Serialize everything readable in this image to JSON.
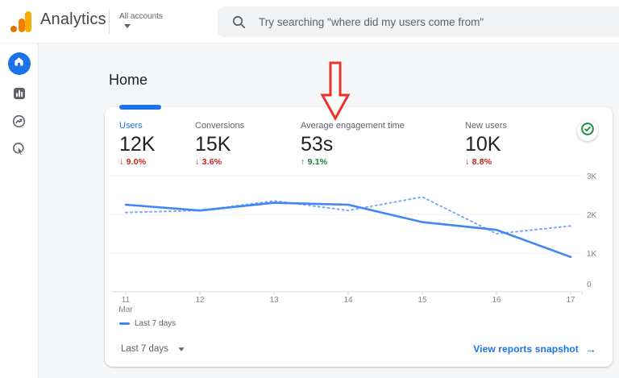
{
  "topbar": {
    "brand": "Analytics",
    "account_switcher": "All accounts",
    "search_placeholder": "Try searching \"where did my users come from\""
  },
  "sidebar": {
    "items": [
      {
        "name": "home",
        "icon": "home-icon",
        "active": true
      },
      {
        "name": "reports",
        "icon": "bar-chart-icon",
        "active": false
      },
      {
        "name": "explore",
        "icon": "explore-trend-icon",
        "active": false
      },
      {
        "name": "advertising",
        "icon": "target-cursor-icon",
        "active": false
      }
    ]
  },
  "page": {
    "title": "Home"
  },
  "card": {
    "metrics": [
      {
        "label": "Users",
        "value": "12K",
        "delta": "9.0%",
        "direction": "down",
        "active": true
      },
      {
        "label": "Conversions",
        "value": "15K",
        "delta": "3.6%",
        "direction": "down",
        "active": false
      },
      {
        "label": "Average engagement time",
        "value": "53s",
        "delta": "9.1%",
        "direction": "up",
        "active": false
      },
      {
        "label": "New users",
        "value": "10K",
        "delta": "8.8%",
        "direction": "down",
        "active": false
      }
    ],
    "status_icon": "check-circle-icon",
    "legend_label": "Last 7 days",
    "footer": {
      "range_label": "Last 7 days",
      "link_label": "View reports snapshot",
      "link_arrow": "→"
    }
  },
  "chart_data": {
    "type": "line",
    "x": [
      "11",
      "12",
      "13",
      "14",
      "15",
      "16",
      "17"
    ],
    "x_first_sublabel": "Mar",
    "y_ticks": [
      "3K",
      "2K",
      "1K",
      "0"
    ],
    "ylim": [
      0,
      3000
    ],
    "grid": "horizontal",
    "legend_position": "bottom-left",
    "series": [
      {
        "name": "Last 7 days",
        "style": "solid",
        "color": "#4285f4",
        "values": [
          2250,
          2100,
          2300,
          2250,
          1800,
          1600,
          900
        ]
      },
      {
        "name": "",
        "style": "dotted",
        "color": "#7baaf7",
        "values": [
          2050,
          2100,
          2350,
          2100,
          2450,
          1500,
          1700
        ]
      }
    ]
  },
  "annotation": {
    "type": "arrow-down",
    "color": "#e8332a"
  },
  "colors": {
    "accent_blue": "#1a73e8",
    "negative_red": "#c5221f",
    "positive_green": "#188038"
  }
}
